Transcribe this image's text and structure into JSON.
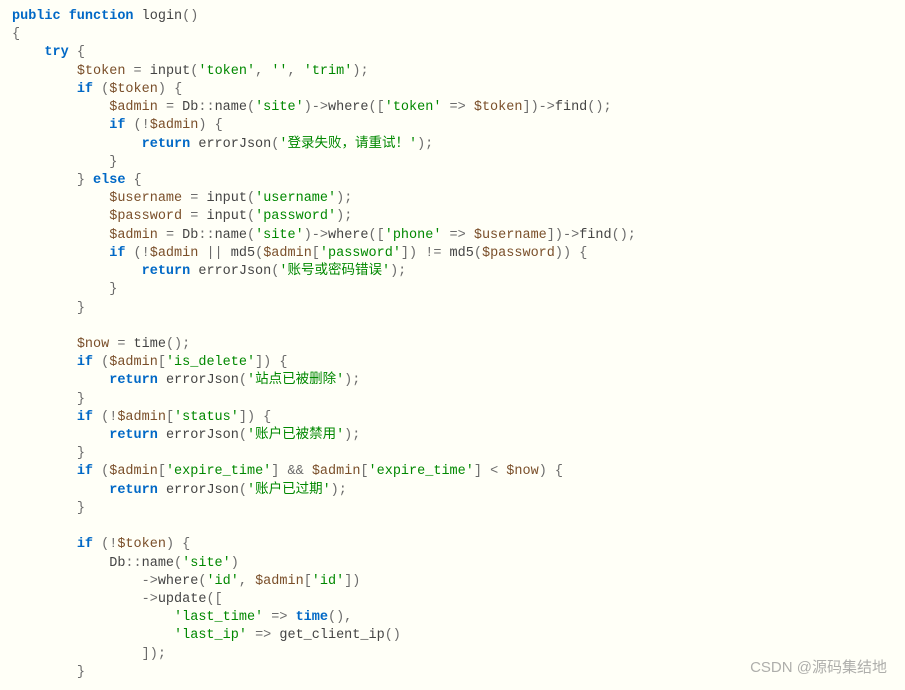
{
  "code": {
    "function_decl": "public function",
    "function_name": "login",
    "try": "try",
    "if": "if",
    "else": "else",
    "return": "return",
    "vars": {
      "token": "$token",
      "admin": "$admin",
      "username": "$username",
      "password": "$password",
      "now": "$now"
    },
    "identifiers": {
      "input": "input",
      "Db": "Db",
      "name": "name",
      "where": "where",
      "find": "find",
      "errorJson": "errorJson",
      "md5": "md5",
      "time": "time",
      "update": "update",
      "get_client_ip": "get_client_ip"
    },
    "strings": {
      "token": "'token'",
      "empty": "''",
      "trim": "'trim'",
      "site": "'site'",
      "login_fail": "'登录失败，请重试！'",
      "username": "'username'",
      "password": "'password'",
      "phone": "'phone'",
      "password_key": "'password'",
      "acct_pwd_err": "'账号或密码错误'",
      "is_delete": "'is_delete'",
      "site_deleted": "'站点已被删除'",
      "status": "'status'",
      "acct_disabled": "'账户已被禁用'",
      "expire_time": "'expire_time'",
      "acct_expired": "'账户已过期'",
      "id": "'id'",
      "last_time": "'last_time'",
      "last_ip": "'last_ip'"
    }
  },
  "watermark": "CSDN @源码集结地"
}
